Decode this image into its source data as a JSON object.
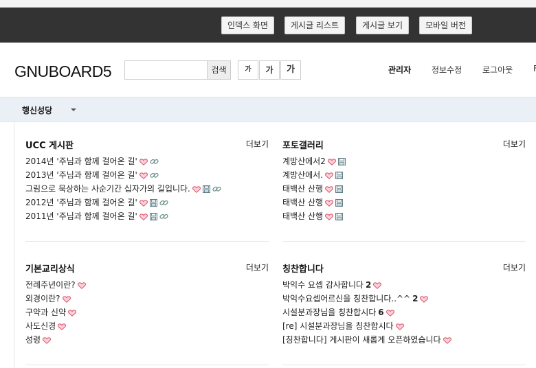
{
  "top_buttons": [
    "인덱스 화면",
    "게시글 리스트",
    "게시글 보기",
    "모바일 버전"
  ],
  "header": {
    "logo": "GNUBOARD5",
    "search_button": "검색",
    "font_buttons": [
      "가",
      "가",
      "가"
    ],
    "nav": [
      "관리자",
      "정보수정",
      "로그아웃",
      "F"
    ]
  },
  "gnb": {
    "menu": "행신성당"
  },
  "boards": [
    {
      "title": "UCC 게시판",
      "more": "더보기",
      "items": [
        {
          "text": "2014년 '주님과 함께 걸어온 길'",
          "icons": [
            "heart-icon",
            "link-icon"
          ]
        },
        {
          "text": "2013년 '주님과 함께 걸어온 길'",
          "icons": [
            "heart-icon",
            "link-icon"
          ]
        },
        {
          "text": "그림으로 묵상하는 사순기간 십자가의 길입니다.",
          "icons": [
            "heart-icon",
            "file-icon",
            "link-icon"
          ]
        },
        {
          "text": "2012년 '주님과 함께 걸어온 길'",
          "icons": [
            "heart-icon",
            "file-icon",
            "link-icon"
          ]
        },
        {
          "text": "2011년 '주님과 함께 걸어온 길'",
          "icons": [
            "heart-icon",
            "file-icon",
            "link-icon"
          ]
        }
      ]
    },
    {
      "title": "포토갤러리",
      "more": "더보기",
      "items": [
        {
          "text": "계방산에서2",
          "icons": [
            "heart-icon",
            "file-icon"
          ]
        },
        {
          "text": "계방산에서.",
          "icons": [
            "heart-icon",
            "file-icon"
          ]
        },
        {
          "text": "태백산 산행",
          "icons": [
            "heart-icon",
            "file-icon"
          ]
        },
        {
          "text": "태백산 산행",
          "icons": [
            "heart-icon",
            "file-icon"
          ]
        },
        {
          "text": "태백산 산행",
          "icons": [
            "heart-icon",
            "file-icon"
          ]
        }
      ]
    },
    {
      "title": "기본교리상식",
      "more": "더보기",
      "items": [
        {
          "text": "전례주년이란?",
          "icons": [
            "heart-icon"
          ]
        },
        {
          "text": "외경이란?",
          "icons": [
            "heart-icon"
          ]
        },
        {
          "text": "구약과 신약",
          "icons": [
            "heart-icon"
          ]
        },
        {
          "text": "사도신경",
          "icons": [
            "heart-icon"
          ]
        },
        {
          "text": "성령",
          "icons": [
            "heart-icon"
          ]
        }
      ]
    },
    {
      "title": "칭찬합니다",
      "more": "더보기",
      "items": [
        {
          "text": "박익수 요셉 감사합니다",
          "count": "2",
          "icons": [
            "heart-icon"
          ]
        },
        {
          "text": "박익수요셉어르신을 칭찬합니다..^^",
          "count": "2",
          "icons": [
            "heart-icon"
          ]
        },
        {
          "text": "시설분과장님을 칭찬합시다",
          "count": "6",
          "icons": [
            "heart-icon"
          ]
        },
        {
          "text": "[re] 시설분과장님을 칭찬합시다",
          "icons": [
            "heart-icon"
          ]
        },
        {
          "text": "[칭찬합니다] 게시판이 새롭게 오픈하였습니다",
          "icons": [
            "heart-icon"
          ]
        }
      ]
    }
  ]
}
